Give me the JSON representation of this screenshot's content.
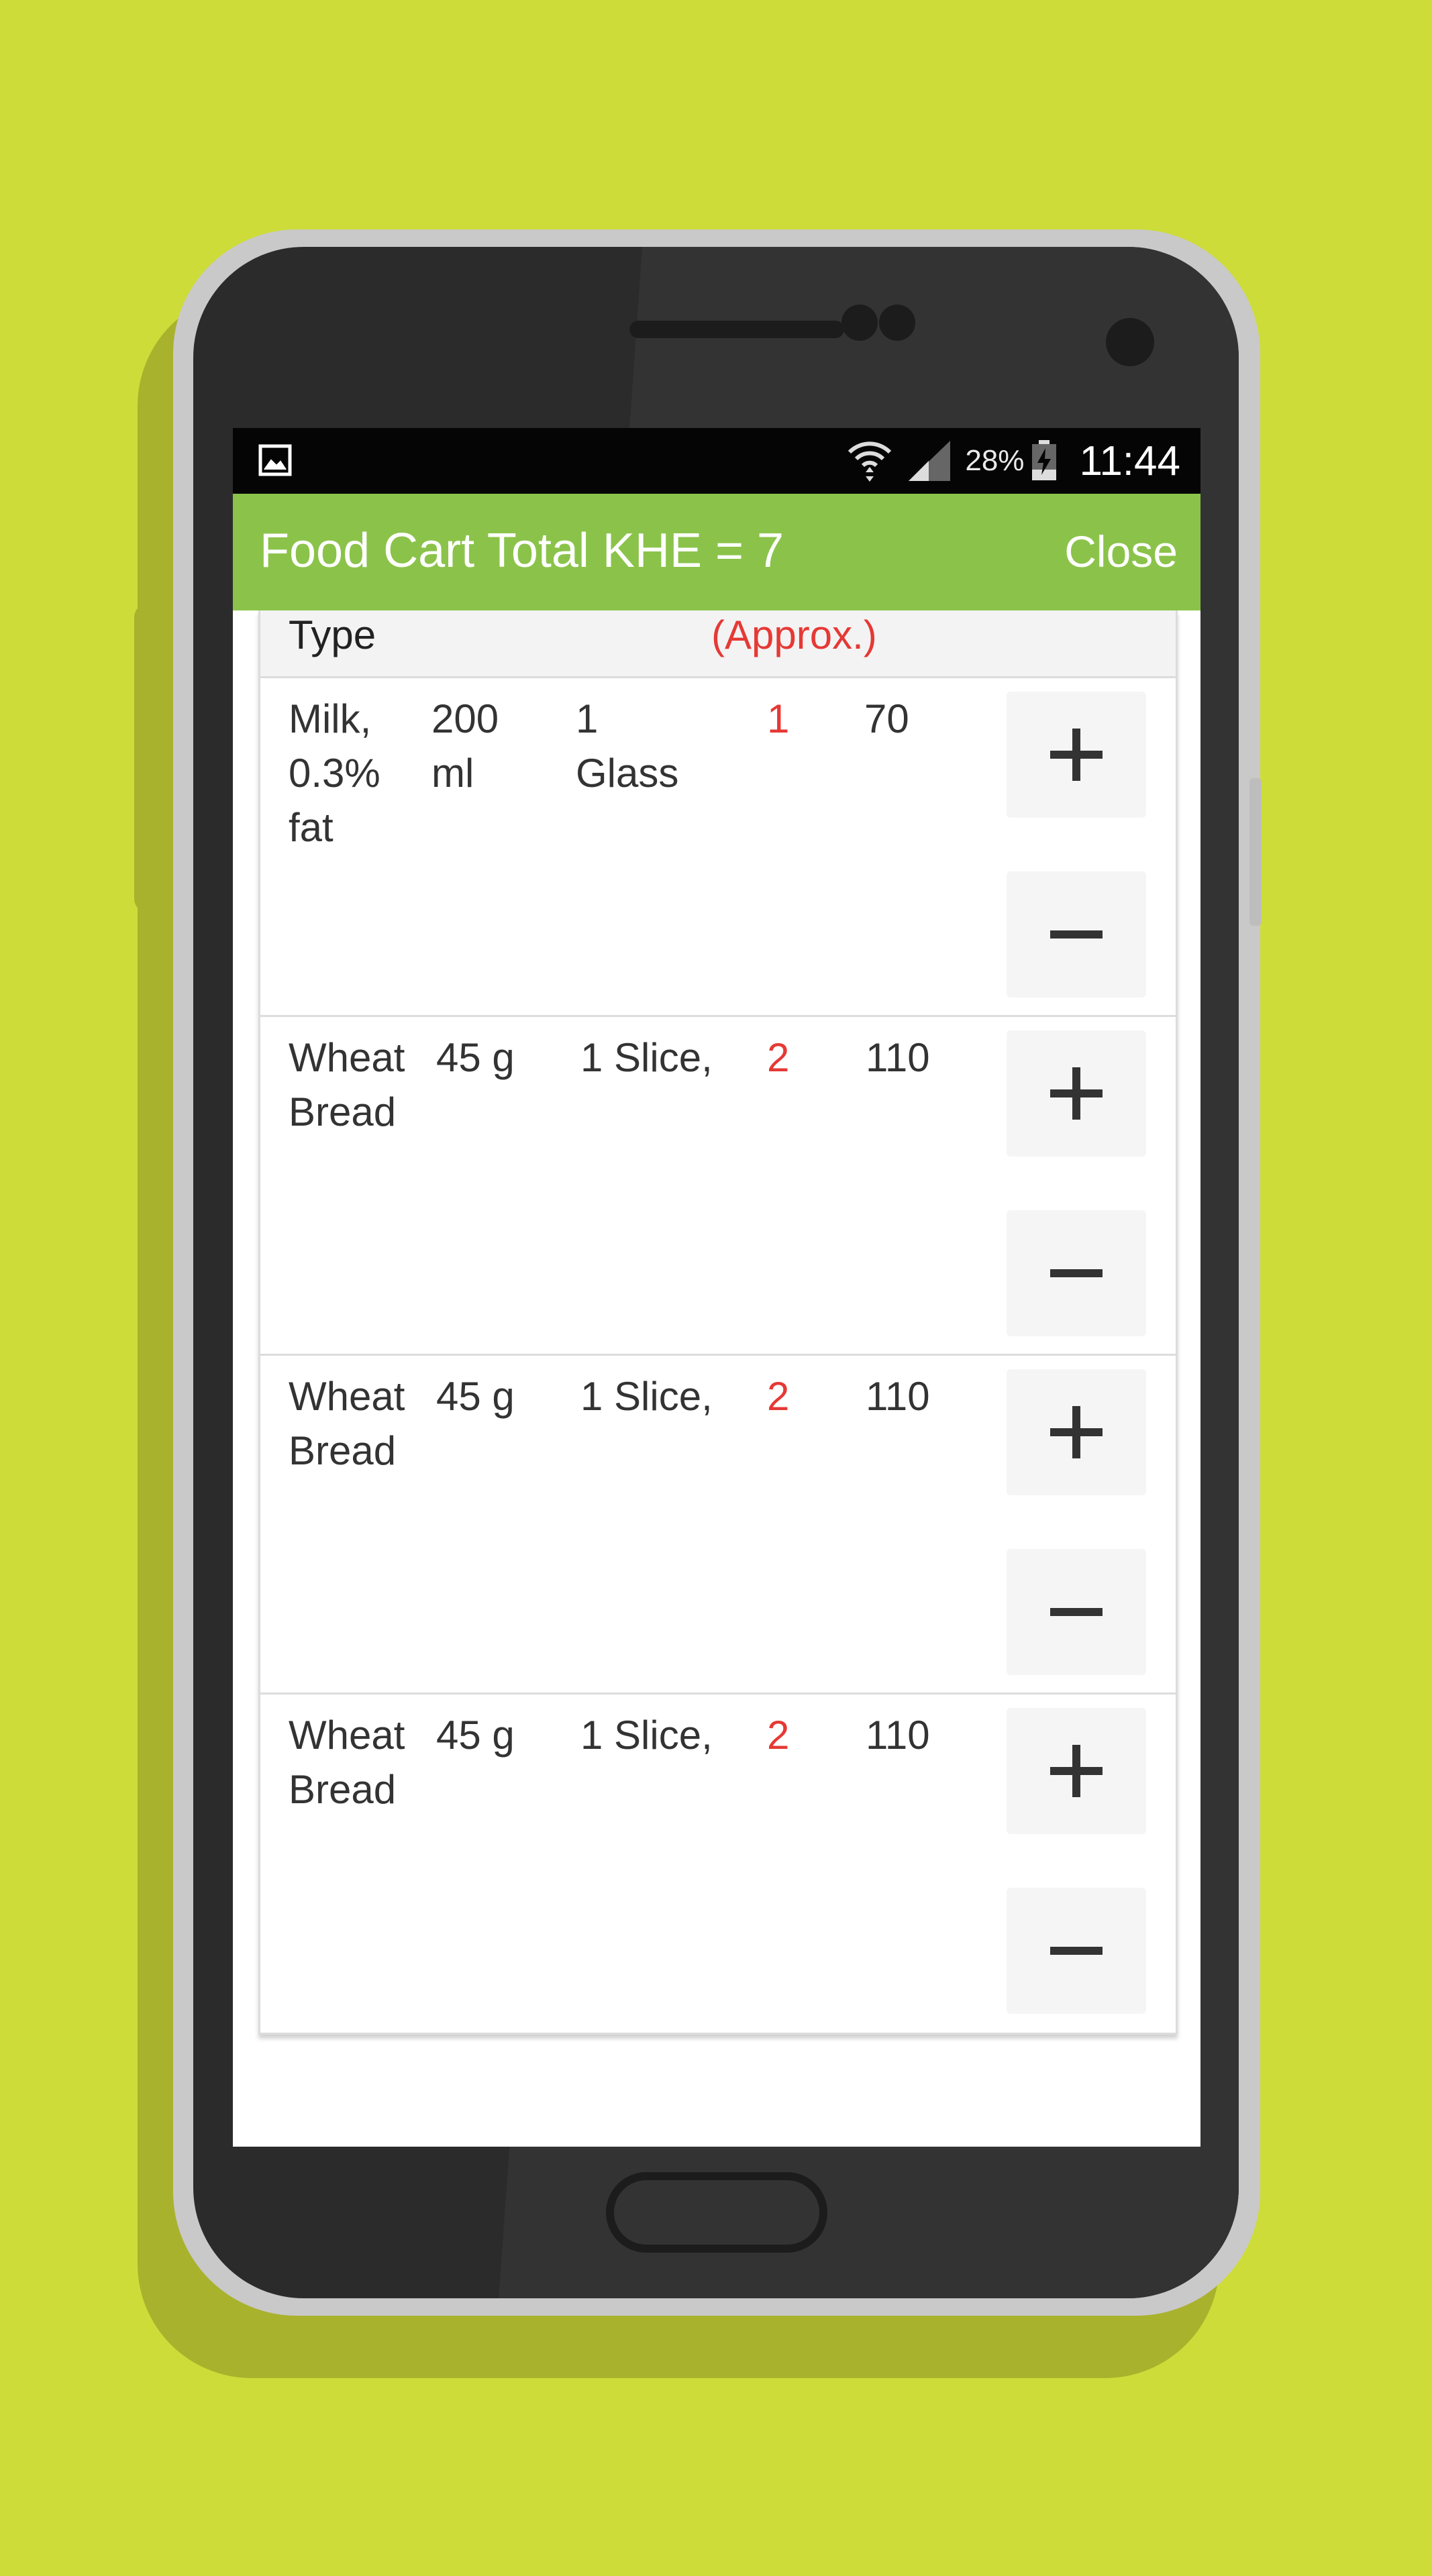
{
  "status_bar": {
    "battery_percent": "28%",
    "time": "11:44"
  },
  "app_bar": {
    "title": "Food Cart Total KHE = 7",
    "close_label": "Close"
  },
  "table": {
    "header": {
      "type_label": "Type",
      "approx_label": "(Approx.)"
    },
    "rows": [
      {
        "name": "Milk, 0.3% fat",
        "size": "200 ml",
        "portion": "1 Glass",
        "khe": "1",
        "kcal": "70"
      },
      {
        "name": "Wheat Bread",
        "size": "45 g",
        "portion": "1 Slice,",
        "khe": "2",
        "kcal": "110"
      },
      {
        "name": "Wheat Bread",
        "size": "45 g",
        "portion": "1 Slice,",
        "khe": "2",
        "kcal": "110"
      },
      {
        "name": "Wheat Bread",
        "size": "45 g",
        "portion": "1 Slice,",
        "khe": "2",
        "kcal": "110"
      }
    ]
  },
  "colors": {
    "background": "#cddc39",
    "app_bar": "#8bc34a",
    "accent_red": "#e53935"
  }
}
